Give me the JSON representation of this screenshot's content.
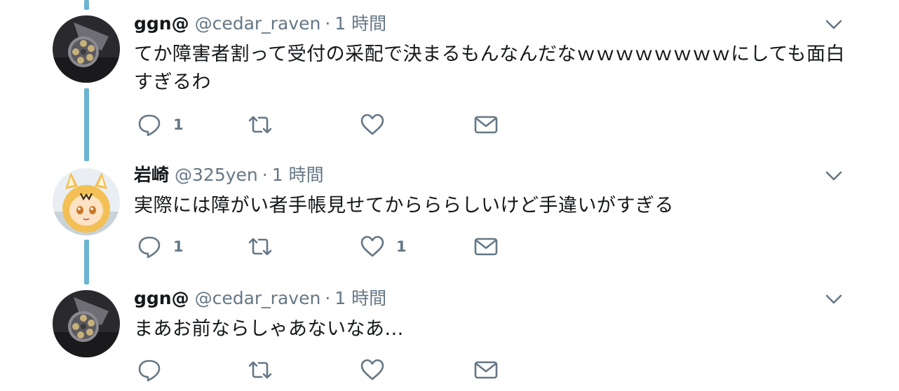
{
  "tweets": [
    {
      "name": "ggn@",
      "handle": "@cedar_raven",
      "separator": "·",
      "time": "1 時間",
      "text": "てか障害者割って受付の采配で決まるもんなんだなｗｗｗｗｗｗｗｗにしても面白すぎるわ",
      "avatar_icon": "revolver-avatar",
      "reply_count": "1",
      "retweet_count": "",
      "like_count": "",
      "accent": "#6bb4d2"
    },
    {
      "name": "岩崎",
      "handle": "@325yen",
      "separator": "·",
      "time": "1 時間",
      "text": "実際には障がい者手帳見せてからららしいけど手違いがすぎる",
      "avatar_icon": "anime-girl-avatar",
      "reply_count": "1",
      "retweet_count": "",
      "like_count": "1"
    },
    {
      "name": "ggn@",
      "handle": "@cedar_raven",
      "separator": "·",
      "time": "1 時間",
      "text": "まあお前ならしゃあないなあ...",
      "avatar_icon": "revolver-avatar",
      "reply_count": "",
      "retweet_count": "",
      "like_count": ""
    }
  ]
}
